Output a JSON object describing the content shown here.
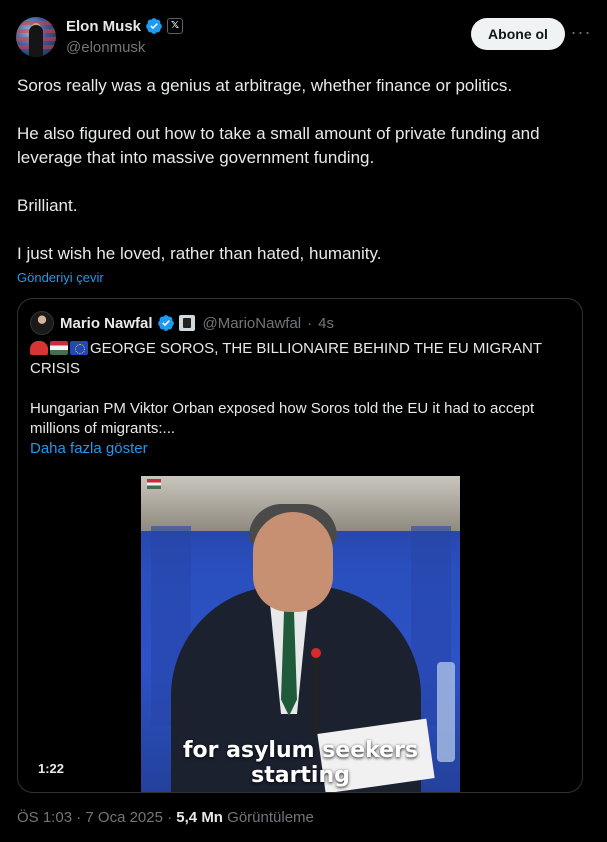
{
  "author": {
    "display_name": "Elon Musk",
    "handle": "@elonmusk",
    "follow_label": "Abone ol",
    "more_glyph": "···",
    "affiliate_badge": "𝕏"
  },
  "tweet": {
    "paragraphs": [
      "Soros really was a genius at arbitrage, whether finance or politics.",
      "He also figured out how to take a small amount of private funding and leverage that into massive government funding.",
      "Brilliant.",
      "I just wish he loved, rather than hated, humanity."
    ],
    "translate_label": "Gönderiyi çevir"
  },
  "quoted": {
    "display_name": "Mario Nawfal",
    "handle": "@MarioNawfal",
    "separator": "·",
    "time": "4s",
    "headline": "GEORGE SOROS, THE BILLIONAIRE BEHIND THE EU MIGRANT CRISIS",
    "body": "Hungarian PM Viktor Orban exposed how Soros told the EU it had to accept millions of migrants:...",
    "show_more": "Daha fazla göster",
    "video": {
      "caption_line1": "for asylum seekers",
      "caption_line2": "starting",
      "duration": "1:22"
    }
  },
  "meta": {
    "time": "ÖS 1:03",
    "separator": "·",
    "date": "7 Oca 2025",
    "separator2": "·",
    "views": "5,4 Mn",
    "views_label": "Görüntüleme"
  },
  "colors": {
    "accent": "#1d9bf0",
    "background": "#000000",
    "text": "#e7e9ea",
    "muted": "#71767b",
    "border": "#2f3336"
  }
}
